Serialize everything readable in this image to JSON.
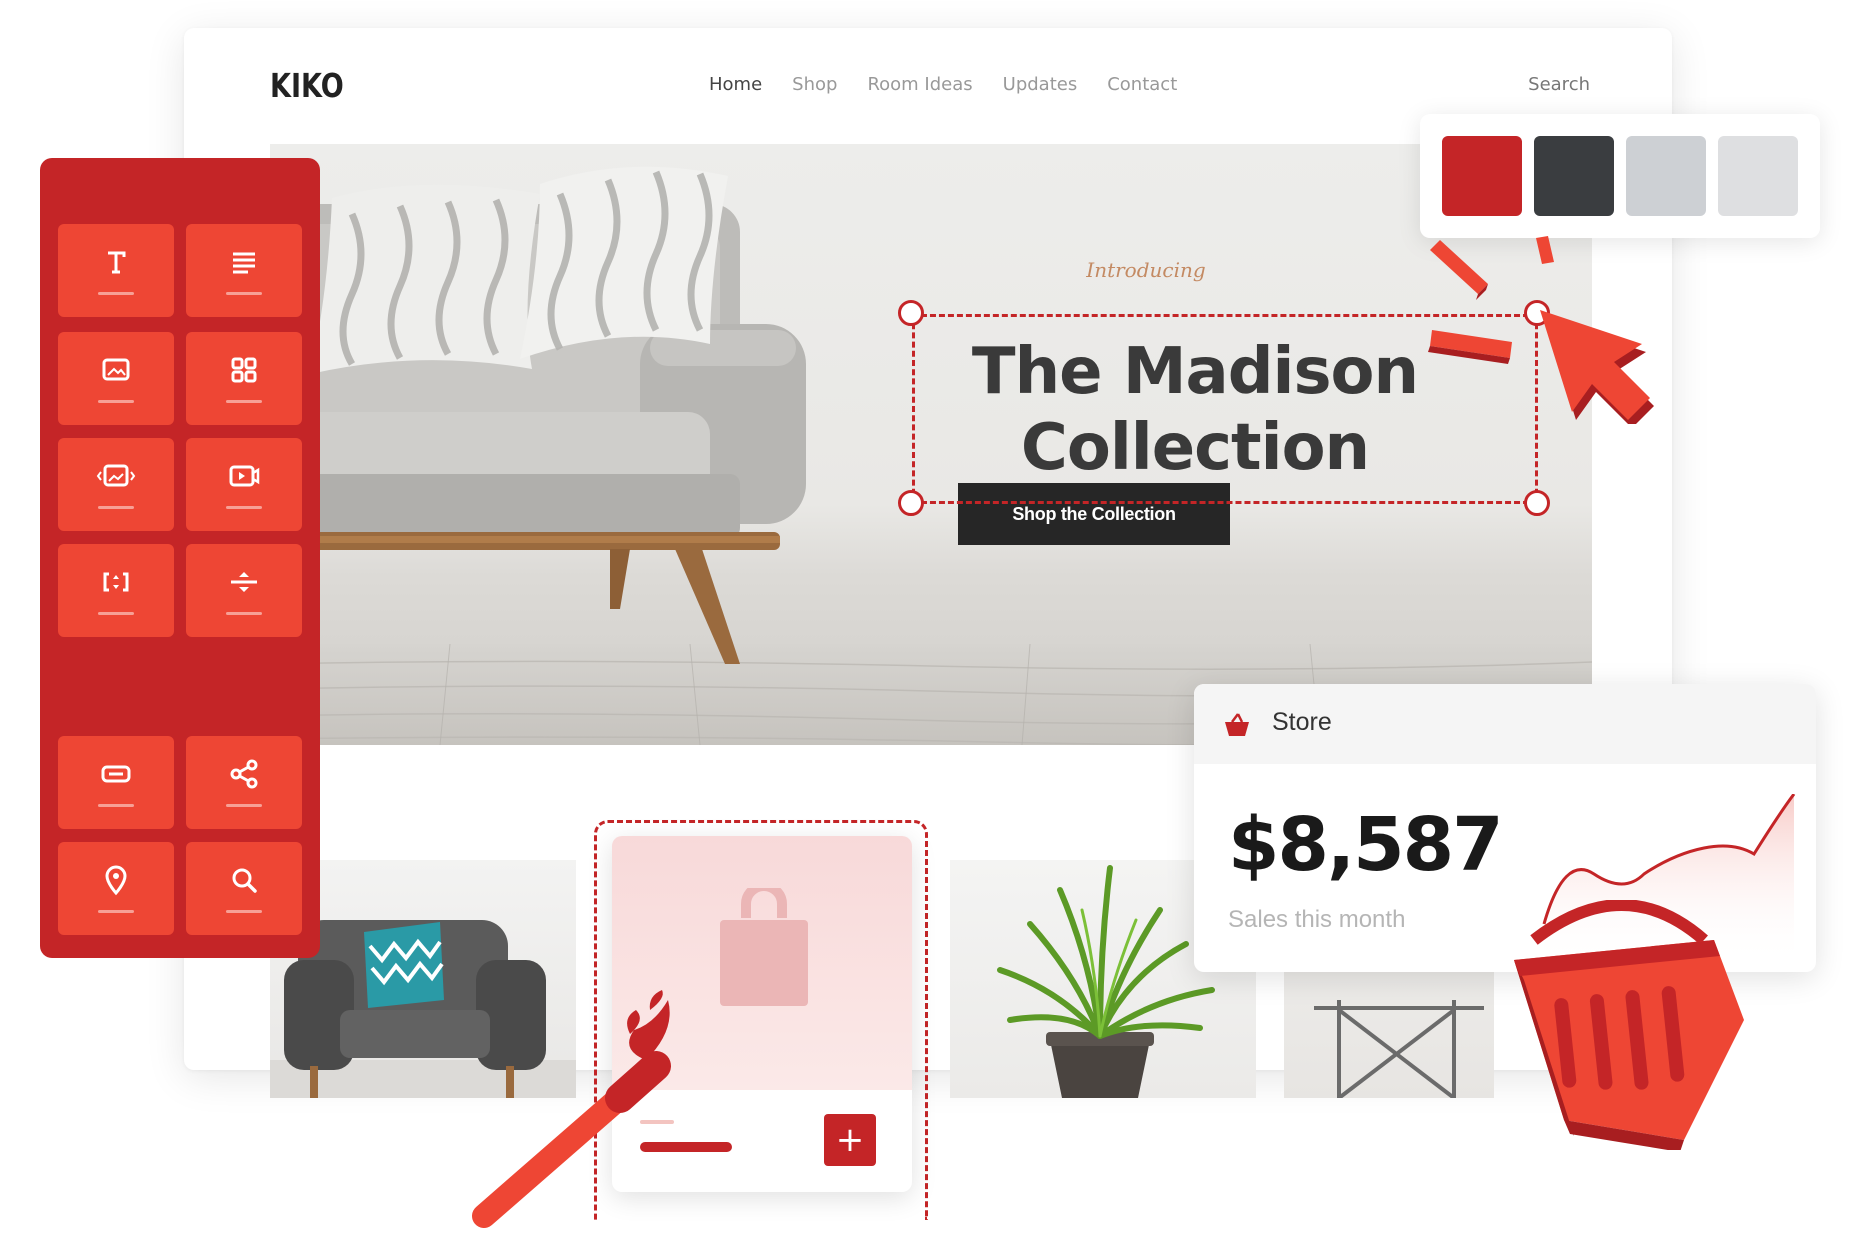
{
  "site": {
    "logo": "KIKO",
    "nav": [
      "Home",
      "Shop",
      "Room Ideas",
      "Updates",
      "Contact"
    ],
    "search_label": "Search"
  },
  "hero": {
    "intro": "Introducing",
    "title_line1": "The Madison",
    "title_line2": "Collection",
    "cta_label": "Shop the Collection"
  },
  "panel": {
    "widgets": [
      "text-widget-icon",
      "text-editor-icon",
      "image-icon",
      "gallery-icon",
      "image-carousel-icon",
      "video-icon",
      "spacer-icon",
      "divider-icon",
      "button-icon",
      "share-icon",
      "map-pin-icon",
      "search-icon"
    ]
  },
  "swatches": {
    "colors": [
      "#c42527",
      "#3a3d40",
      "#cdd0d4",
      "#dedfe1"
    ]
  },
  "store": {
    "title": "Store",
    "value": "$8,587",
    "subtitle": "Sales this month"
  },
  "product_card": {
    "add_label": "+"
  },
  "colors": {
    "accent": "#c42527",
    "accent_light": "#ee4634",
    "dark": "#262626"
  }
}
